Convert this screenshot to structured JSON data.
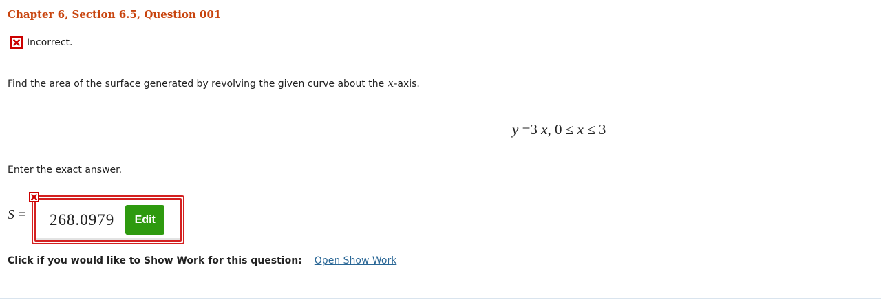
{
  "header": {
    "title": "Chapter 6, Section 6.5, Question 001"
  },
  "status": {
    "icon": "incorrect-x-icon",
    "text": "Incorrect.",
    "color": "#cc0000"
  },
  "question": {
    "text_before": "Find the area of the surface generated by revolving the given curve about the ",
    "variable": "x",
    "text_after": "-axis."
  },
  "formula": {
    "lhs_var": "y",
    "equals_coef": " =3 ",
    "rhs_var": "x",
    "separator": ", 0 ≤ ",
    "bound_var": "x",
    "upper": " ≤ 3"
  },
  "instruction": {
    "text": "Enter the exact answer."
  },
  "answer": {
    "label_var": "S",
    "label_eq": " =",
    "value": "268.0979",
    "edit_label": "Edit",
    "flag_icon": "incorrect-x-icon",
    "edit_color": "#2e9a0f",
    "error_color": "#d42020"
  },
  "show_work": {
    "label": "Click if you would like to Show Work for this question:",
    "link": "Open Show Work",
    "link_color": "#2a6796"
  },
  "colors": {
    "title": "#c8440e",
    "text": "#222222"
  }
}
